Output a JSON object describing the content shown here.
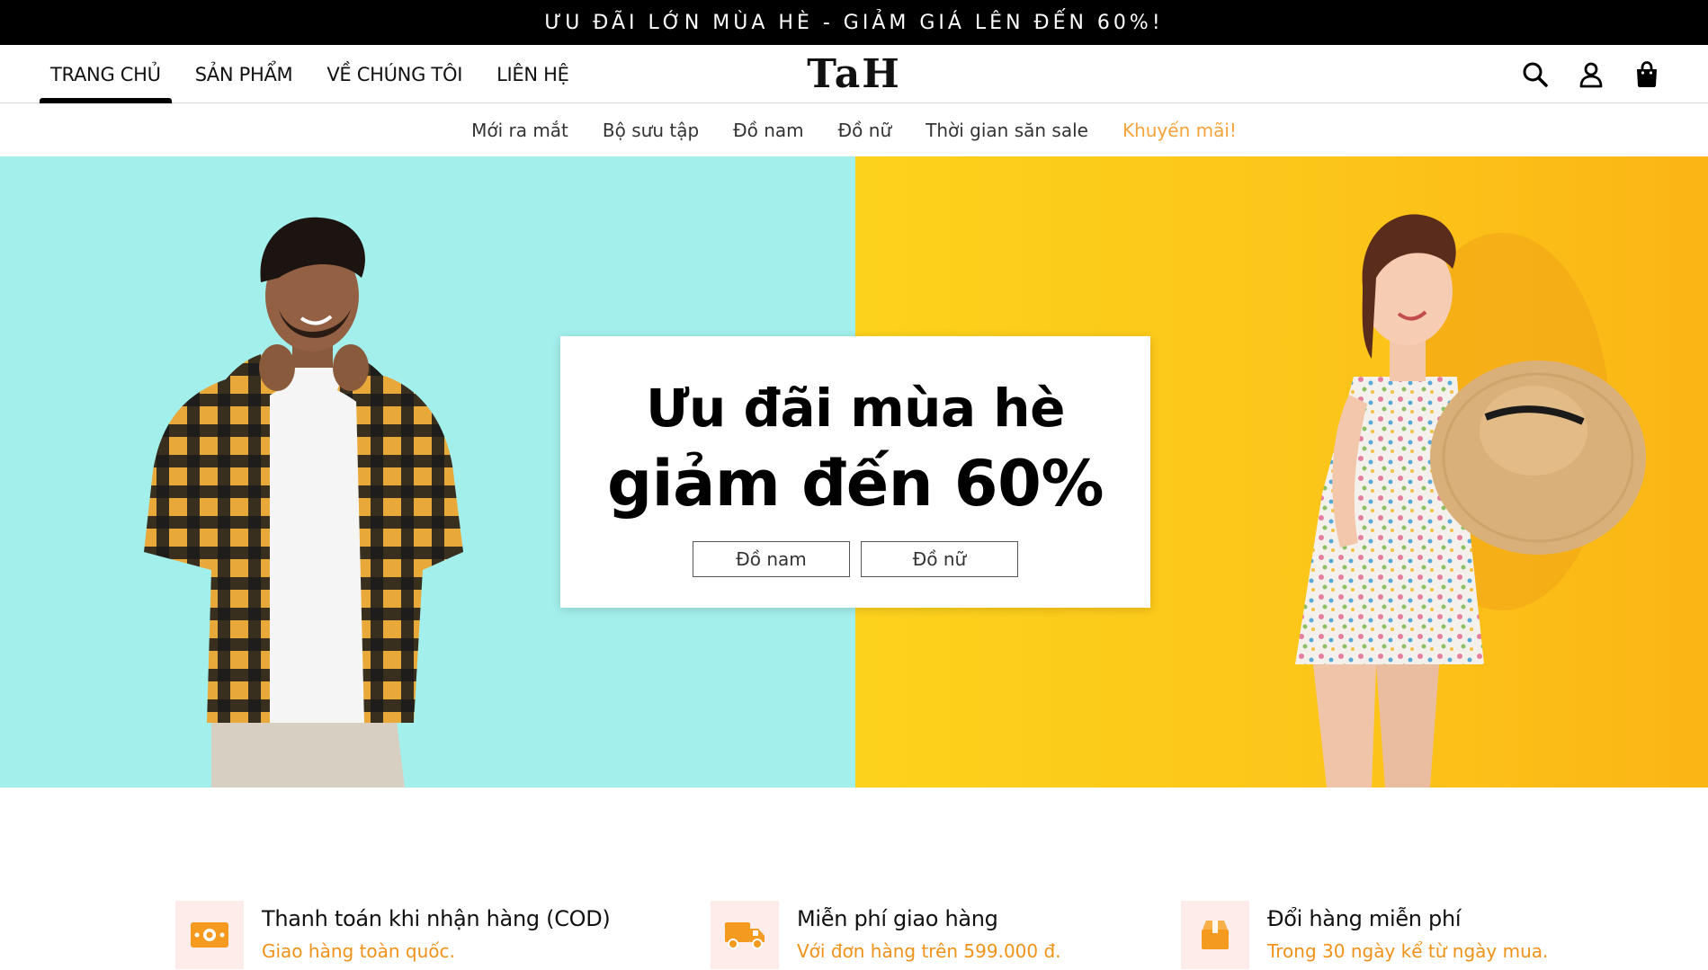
{
  "promo_bar": {
    "text": "ƯU ĐÃI LỚN MÙA HÈ - GIẢM GIÁ LÊN ĐẾN 60%!"
  },
  "header": {
    "nav": [
      {
        "label": "TRANG CHỦ",
        "active": true
      },
      {
        "label": "SẢN PHẨM",
        "active": false
      },
      {
        "label": "VỀ CHÚNG TÔI",
        "active": false
      },
      {
        "label": "LIÊN HỆ",
        "active": false
      }
    ],
    "logo": "TaH",
    "icons": [
      "search-icon",
      "user-icon",
      "shopping-bag-icon"
    ]
  },
  "sub_nav": [
    {
      "label": "Mới ra mắt"
    },
    {
      "label": "Bộ sưu tập"
    },
    {
      "label": "Đồ nam"
    },
    {
      "label": "Đồ nữ"
    },
    {
      "label": "Thời gian săn sale"
    },
    {
      "label": "Khuyến mãi!"
    }
  ],
  "hero": {
    "title_line1": "Ưu đãi mùa hè",
    "title_line2": "giảm đến 60%",
    "buttons": [
      {
        "label": "Đồ nam"
      },
      {
        "label": "Đồ nữ"
      }
    ],
    "colors": {
      "left_bg": "#a3efec",
      "right_bg": "#fcc419"
    }
  },
  "features": [
    {
      "title": "Thanh toán khi nhận hàng (COD)",
      "subtitle": "Giao hàng toàn quốc.",
      "icon": "cash-icon"
    },
    {
      "title": "Miễn phí giao hàng",
      "subtitle": "Với đơn hàng trên 599.000 đ.",
      "icon": "truck-icon"
    },
    {
      "title": "Đổi hàng miễn phí",
      "subtitle": "Trong 30 ngày kể từ ngày mua.",
      "icon": "box-icon"
    }
  ],
  "colors": {
    "accent": "#f5a33a",
    "promo_bar_bg": "#000000"
  }
}
